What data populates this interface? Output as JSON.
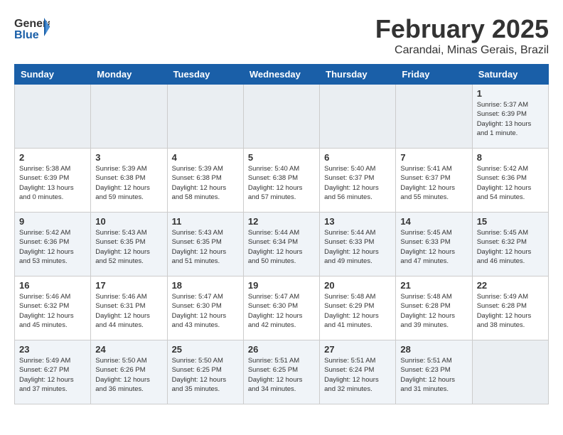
{
  "header": {
    "logo_general": "General",
    "logo_blue": "Blue",
    "month_year": "February 2025",
    "location": "Carandai, Minas Gerais, Brazil"
  },
  "weekdays": [
    "Sunday",
    "Monday",
    "Tuesday",
    "Wednesday",
    "Thursday",
    "Friday",
    "Saturday"
  ],
  "weeks": [
    [
      {
        "day": "",
        "info": ""
      },
      {
        "day": "",
        "info": ""
      },
      {
        "day": "",
        "info": ""
      },
      {
        "day": "",
        "info": ""
      },
      {
        "day": "",
        "info": ""
      },
      {
        "day": "",
        "info": ""
      },
      {
        "day": "1",
        "info": "Sunrise: 5:37 AM\nSunset: 6:39 PM\nDaylight: 13 hours\nand 1 minute."
      }
    ],
    [
      {
        "day": "2",
        "info": "Sunrise: 5:38 AM\nSunset: 6:39 PM\nDaylight: 13 hours\nand 0 minutes."
      },
      {
        "day": "3",
        "info": "Sunrise: 5:39 AM\nSunset: 6:38 PM\nDaylight: 12 hours\nand 59 minutes."
      },
      {
        "day": "4",
        "info": "Sunrise: 5:39 AM\nSunset: 6:38 PM\nDaylight: 12 hours\nand 58 minutes."
      },
      {
        "day": "5",
        "info": "Sunrise: 5:40 AM\nSunset: 6:38 PM\nDaylight: 12 hours\nand 57 minutes."
      },
      {
        "day": "6",
        "info": "Sunrise: 5:40 AM\nSunset: 6:37 PM\nDaylight: 12 hours\nand 56 minutes."
      },
      {
        "day": "7",
        "info": "Sunrise: 5:41 AM\nSunset: 6:37 PM\nDaylight: 12 hours\nand 55 minutes."
      },
      {
        "day": "8",
        "info": "Sunrise: 5:42 AM\nSunset: 6:36 PM\nDaylight: 12 hours\nand 54 minutes."
      }
    ],
    [
      {
        "day": "9",
        "info": "Sunrise: 5:42 AM\nSunset: 6:36 PM\nDaylight: 12 hours\nand 53 minutes."
      },
      {
        "day": "10",
        "info": "Sunrise: 5:43 AM\nSunset: 6:35 PM\nDaylight: 12 hours\nand 52 minutes."
      },
      {
        "day": "11",
        "info": "Sunrise: 5:43 AM\nSunset: 6:35 PM\nDaylight: 12 hours\nand 51 minutes."
      },
      {
        "day": "12",
        "info": "Sunrise: 5:44 AM\nSunset: 6:34 PM\nDaylight: 12 hours\nand 50 minutes."
      },
      {
        "day": "13",
        "info": "Sunrise: 5:44 AM\nSunset: 6:33 PM\nDaylight: 12 hours\nand 49 minutes."
      },
      {
        "day": "14",
        "info": "Sunrise: 5:45 AM\nSunset: 6:33 PM\nDaylight: 12 hours\nand 47 minutes."
      },
      {
        "day": "15",
        "info": "Sunrise: 5:45 AM\nSunset: 6:32 PM\nDaylight: 12 hours\nand 46 minutes."
      }
    ],
    [
      {
        "day": "16",
        "info": "Sunrise: 5:46 AM\nSunset: 6:32 PM\nDaylight: 12 hours\nand 45 minutes."
      },
      {
        "day": "17",
        "info": "Sunrise: 5:46 AM\nSunset: 6:31 PM\nDaylight: 12 hours\nand 44 minutes."
      },
      {
        "day": "18",
        "info": "Sunrise: 5:47 AM\nSunset: 6:30 PM\nDaylight: 12 hours\nand 43 minutes."
      },
      {
        "day": "19",
        "info": "Sunrise: 5:47 AM\nSunset: 6:30 PM\nDaylight: 12 hours\nand 42 minutes."
      },
      {
        "day": "20",
        "info": "Sunrise: 5:48 AM\nSunset: 6:29 PM\nDaylight: 12 hours\nand 41 minutes."
      },
      {
        "day": "21",
        "info": "Sunrise: 5:48 AM\nSunset: 6:28 PM\nDaylight: 12 hours\nand 39 minutes."
      },
      {
        "day": "22",
        "info": "Sunrise: 5:49 AM\nSunset: 6:28 PM\nDaylight: 12 hours\nand 38 minutes."
      }
    ],
    [
      {
        "day": "23",
        "info": "Sunrise: 5:49 AM\nSunset: 6:27 PM\nDaylight: 12 hours\nand 37 minutes."
      },
      {
        "day": "24",
        "info": "Sunrise: 5:50 AM\nSunset: 6:26 PM\nDaylight: 12 hours\nand 36 minutes."
      },
      {
        "day": "25",
        "info": "Sunrise: 5:50 AM\nSunset: 6:25 PM\nDaylight: 12 hours\nand 35 minutes."
      },
      {
        "day": "26",
        "info": "Sunrise: 5:51 AM\nSunset: 6:25 PM\nDaylight: 12 hours\nand 34 minutes."
      },
      {
        "day": "27",
        "info": "Sunrise: 5:51 AM\nSunset: 6:24 PM\nDaylight: 12 hours\nand 32 minutes."
      },
      {
        "day": "28",
        "info": "Sunrise: 5:51 AM\nSunset: 6:23 PM\nDaylight: 12 hours\nand 31 minutes."
      },
      {
        "day": "",
        "info": ""
      }
    ]
  ]
}
